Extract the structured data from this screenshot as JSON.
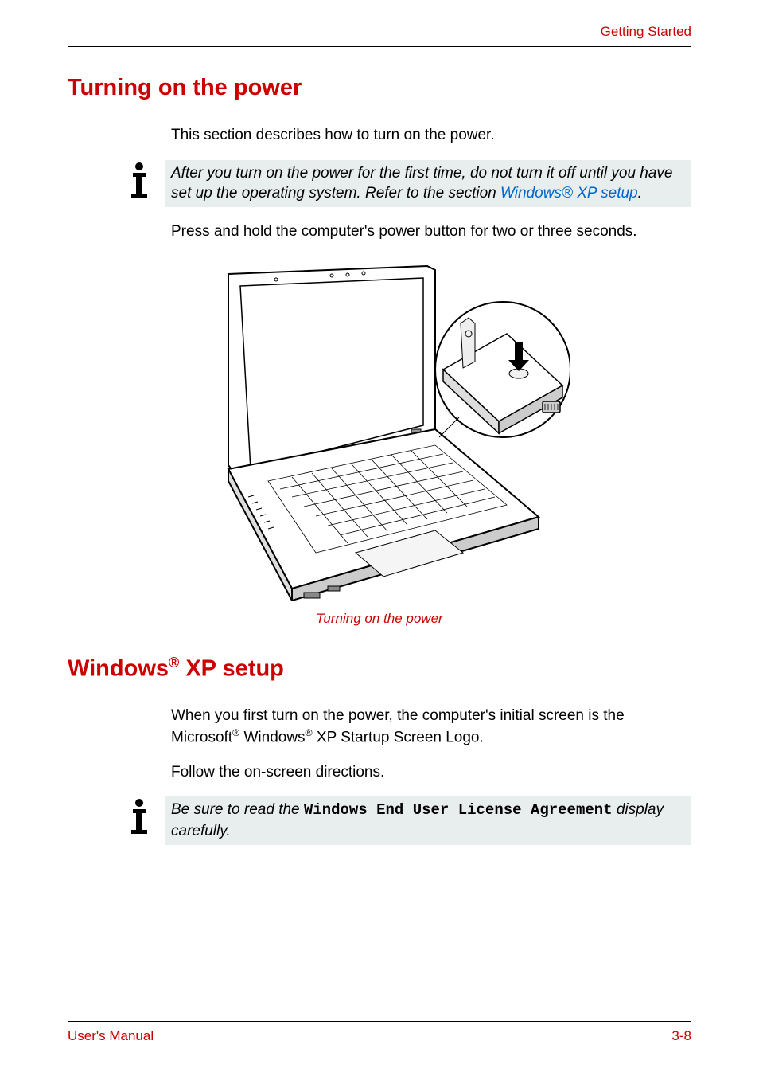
{
  "header": {
    "chapter": "Getting Started"
  },
  "section1": {
    "title": "Turning on the power",
    "intro": "This section describes how to turn on the power.",
    "note_part1": "After you turn on the power for the first time, do not turn it off until you have set up the operating system. Refer to the section ",
    "note_link": "Windows® XP setup",
    "note_part2": ".",
    "instruction": "Press and hold the computer's power button for two or three seconds.",
    "caption": "Turning on the power"
  },
  "section2": {
    "title_pre": "Windows",
    "title_sup": "®",
    "title_post": " XP setup",
    "para1_pre": "When you first turn on the power, the computer's initial screen is the Microsoft",
    "para1_sup1": "®",
    "para1_mid": " Windows",
    "para1_sup2": "®",
    "para1_post": " XP Startup Screen Logo.",
    "para2": "Follow the on-screen directions.",
    "note_pre": "Be sure to read the ",
    "note_mono": "Windows End User License Agreement",
    "note_post": " display carefully."
  },
  "footer": {
    "left": "User's Manual",
    "right": "3-8"
  }
}
